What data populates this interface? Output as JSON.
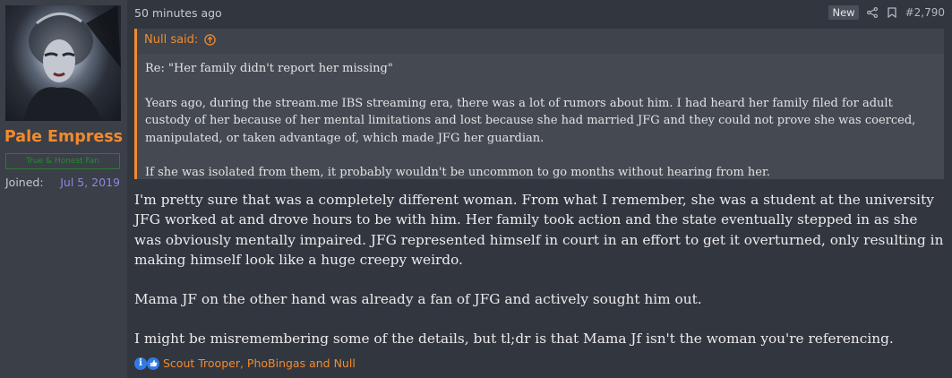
{
  "user": {
    "name": "Pale Empress",
    "title": "True & Honest Fan",
    "joined_label": "Joined:",
    "joined_date": "Jul 5, 2019"
  },
  "post": {
    "time": "50 minutes ago",
    "badge": "New",
    "number": "#2,790",
    "quote": {
      "author": "Null said:",
      "paragraphs": [
        "Re: \"Her family didn't report her missing\"",
        "Years ago, during the stream.me IBS streaming era, there was a lot of rumors about him. I had heard her family filed for adult custody of her because of her mental limitations and lost because she had married JFG and they could not prove she was coerced, manipulated, or taken advantage of, which made JFG her guardian.",
        "If she was isolated from them, it probably wouldn't be uncommon to go months without hearing from her."
      ]
    },
    "message": [
      "I'm pretty sure that was a completely different woman. From what I remember, she was a student at the university JFG worked at and drove hours to be with him. Her family took action and the state eventually stepped in as she was obviously mentally impaired. JFG represented himself in court in an effort to get it overturned, only resulting in making himself look like a huge creepy weirdo.",
      "Mama JF on the other hand was already a fan of JFG and actively sought him out.",
      "I might be misremembering some of the details, but tl;dr is that Mama Jf isn't the woman you're referencing."
    ],
    "reactions_text": "Scout Trooper, PhoBingas and Null",
    "icons": {
      "share": "share-icon",
      "bookmark": "bookmark-icon",
      "quote_up": "arrow-up-circle-icon",
      "informative": "info-icon",
      "like": "thumbs-up-icon"
    }
  },
  "colors": {
    "accent": "#f28a2e",
    "background": "#32363f",
    "sidebar": "#3a3f48",
    "quote_bg": "#444952",
    "joined_date": "#8e86e0",
    "title_green": "#2b8a35",
    "reaction_blue": "#2f7be6"
  }
}
